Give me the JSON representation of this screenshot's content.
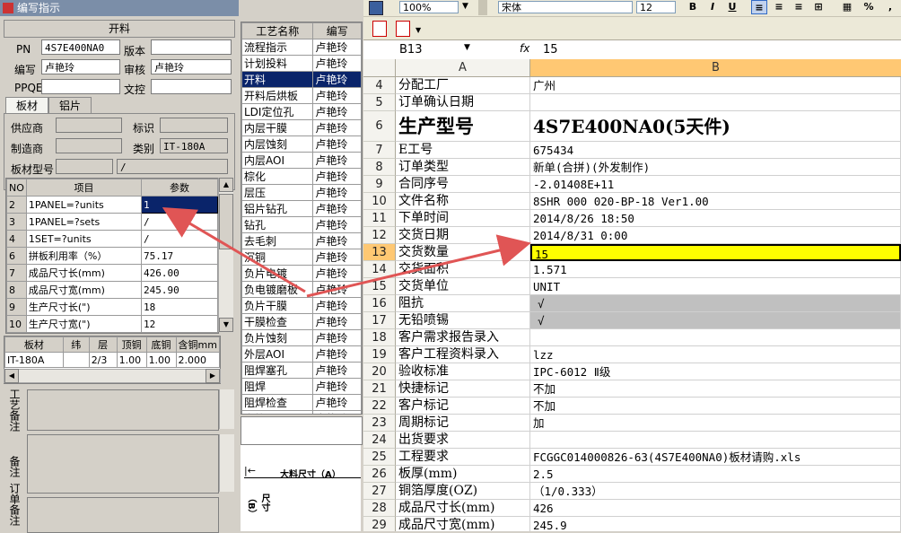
{
  "left_window": {
    "title": "编写指示",
    "section_title": "开料",
    "fields": {
      "pn_label": "PN",
      "pn_value": "4S7E400NA0",
      "version_label": "版本",
      "version_value": "",
      "writer_label": "编写",
      "writer_value": "卢艳玲",
      "reviewer_label": "审核",
      "reviewer_value": "卢艳玲",
      "ppqe_label": "PPQE",
      "ppqe_value": "",
      "doc_control_label": "文控",
      "doc_control_value": ""
    },
    "tabs": [
      "板材",
      "铝片"
    ],
    "material": {
      "supplier_label": "供应商",
      "supplier_value": "",
      "mark_label": "标识",
      "mark_value": "",
      "maker_label": "制造商",
      "maker_value": "",
      "category_label": "类别",
      "category_value": "IT-180A",
      "model_label": "板材型号",
      "model_value": "",
      "model_value2": "/"
    },
    "param_table": {
      "headers": [
        "NO",
        "项目",
        "参数"
      ],
      "rows": [
        {
          "no": "2",
          "item": "1PANEL=?units",
          "value": "1"
        },
        {
          "no": "3",
          "item": "1PANEL=?sets",
          "value": "/"
        },
        {
          "no": "4",
          "item": "1SET=?units",
          "value": "/"
        },
        {
          "no": "6",
          "item": "拼板利用率（%）",
          "value": "75.17"
        },
        {
          "no": "7",
          "item": "成品尺寸长(mm)",
          "value": "426.00"
        },
        {
          "no": "8",
          "item": "成品尺寸宽(mm)",
          "value": "245.90"
        },
        {
          "no": "9",
          "item": "生产尺寸长(\")",
          "value": "18"
        },
        {
          "no": "10",
          "item": "生产尺寸宽(\")",
          "value": "12"
        }
      ]
    },
    "material_table": {
      "headers": [
        "板材",
        "纬",
        "层",
        "顶铜",
        "底铜",
        "含铜mm"
      ],
      "rows": [
        {
          "board": "IT-180A",
          "weft": "",
          "layer": "2/3",
          "top": "1.00",
          "bottom": "1.00",
          "cu": "2.000"
        }
      ]
    },
    "notes": [
      "工艺备注",
      "备注",
      "订单备注"
    ]
  },
  "process_list": {
    "headers": [
      "工艺名称",
      "编写"
    ],
    "items": [
      {
        "name": "流程指示",
        "writer": "卢艳玲"
      },
      {
        "name": "计划投料",
        "writer": "卢艳玲"
      },
      {
        "name": "开料",
        "writer": "卢艳玲"
      },
      {
        "name": "开料后烘板",
        "writer": "卢艳玲"
      },
      {
        "name": "LDI定位孔",
        "writer": "卢艳玲"
      },
      {
        "name": "内层干膜",
        "writer": "卢艳玲"
      },
      {
        "name": "内层蚀刻",
        "writer": "卢艳玲"
      },
      {
        "name": "内层AOI",
        "writer": "卢艳玲"
      },
      {
        "name": "棕化",
        "writer": "卢艳玲"
      },
      {
        "name": "层压",
        "writer": "卢艳玲"
      },
      {
        "name": "铝片钻孔",
        "writer": "卢艳玲"
      },
      {
        "name": "钻孔",
        "writer": "卢艳玲"
      },
      {
        "name": "去毛刺",
        "writer": "卢艳玲"
      },
      {
        "name": "沉铜",
        "writer": "卢艳玲"
      },
      {
        "name": "负片电镀",
        "writer": "卢艳玲"
      },
      {
        "name": "负电镀磨板",
        "writer": "卢艳玲"
      },
      {
        "name": "负片干膜",
        "writer": "卢艳玲"
      },
      {
        "name": "干膜检查",
        "writer": "卢艳玲"
      },
      {
        "name": "负片蚀刻",
        "writer": "卢艳玲"
      },
      {
        "name": "外层AOI",
        "writer": "卢艳玲"
      },
      {
        "name": "阻焊塞孔",
        "writer": "卢艳玲"
      },
      {
        "name": "阻焊",
        "writer": "卢艳玲"
      },
      {
        "name": "阻焊检查",
        "writer": "卢艳玲"
      },
      {
        "name": "字符",
        "writer": "卢艳玲"
      }
    ],
    "diagram_label_a": "大料尺寸（A）",
    "diagram_label_b": "尺寸（B）"
  },
  "spreadsheet": {
    "toolbar": {
      "zoom": "100%",
      "font": "宋体",
      "size": "12",
      "bold": "B",
      "italic": "I",
      "underline": "U",
      "percent": "%"
    },
    "name_box": "B13",
    "fx": "fx",
    "formula": "15",
    "col_headers": [
      "A",
      "B"
    ],
    "rows": [
      {
        "n": "4",
        "a": "分配工厂",
        "b": "广州"
      },
      {
        "n": "5",
        "a": "订单确认日期",
        "b": ""
      },
      {
        "n": "6",
        "a": "生产型号",
        "b": "4S7E400NA0(5天件)"
      },
      {
        "n": "7",
        "a": "E工号",
        "b": "675434"
      },
      {
        "n": "8",
        "a": "订单类型",
        "b": "新单(合拼)(外发制作)"
      },
      {
        "n": "9",
        "a": "合同序号",
        "b": "-2.01408E+11"
      },
      {
        "n": "10",
        "a": "文件名称",
        "b": "8SHR 000 020-BP-18 Ver1.00"
      },
      {
        "n": "11",
        "a": "下单时间",
        "b": "2014/8/26 18:50"
      },
      {
        "n": "12",
        "a": "交货日期",
        "b": "2014/8/31 0:00"
      },
      {
        "n": "13",
        "a": "交货数量",
        "b": "15"
      },
      {
        "n": "14",
        "a": "交货面积",
        "b": "1.571"
      },
      {
        "n": "15",
        "a": "交货单位",
        "b": "UNIT"
      },
      {
        "n": "16",
        "a": "阻抗",
        "b": "√"
      },
      {
        "n": "17",
        "a": "无铅喷锡",
        "b": "√"
      },
      {
        "n": "18",
        "a": "客户需求报告录入",
        "b": ""
      },
      {
        "n": "19",
        "a": "客户工程资料录入",
        "b": "lzz"
      },
      {
        "n": "20",
        "a": "验收标准",
        "b": "IPC-6012 Ⅱ级"
      },
      {
        "n": "21",
        "a": "快捷标记",
        "b": "不加"
      },
      {
        "n": "22",
        "a": "客户标记",
        "b": "不加"
      },
      {
        "n": "23",
        "a": "周期标记",
        "b": "加"
      },
      {
        "n": "24",
        "a": "出货要求",
        "b": ""
      },
      {
        "n": "25",
        "a": "工程要求",
        "b": "FCGGC014000826-63(4S7E400NA0)板材请购.xls"
      },
      {
        "n": "26",
        "a": "板厚(mm)",
        "b": "2.5"
      },
      {
        "n": "27",
        "a": "铜箔厚度(OZ)",
        "b": "（1/0.333）"
      },
      {
        "n": "28",
        "a": "成品尺寸长(mm)",
        "b": "426"
      },
      {
        "n": "29",
        "a": "成品尺寸宽(mm)",
        "b": "245.9"
      }
    ]
  },
  "colors": {
    "selection": "#0a246a",
    "highlight_cell": "#ffff00",
    "arrow": "#e05555"
  }
}
